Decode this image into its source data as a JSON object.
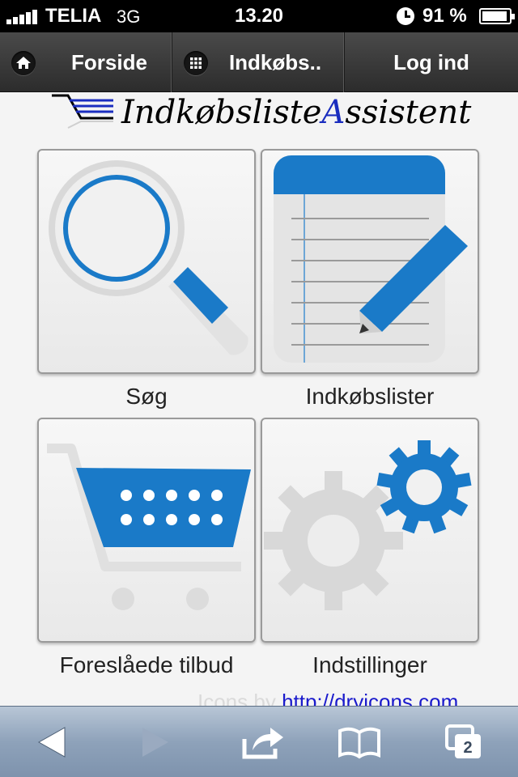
{
  "status_bar": {
    "carrier": "TELIA",
    "network": "3G",
    "time": "13.20",
    "battery_percent": "91 %"
  },
  "nav": {
    "home_label": "Forside",
    "lists_label": "Indkøbs..",
    "login_label": "Log ind"
  },
  "logo": {
    "text_part1": "Indkøbsliste",
    "text_part2": "A",
    "text_part3": "ssistent"
  },
  "tiles": [
    {
      "label": "Søg",
      "icon": "magnifier-icon"
    },
    {
      "label": "Indkøbslister",
      "icon": "notepad-pencil-icon"
    },
    {
      "label": "Foreslåede tilbud",
      "icon": "shopping-cart-icon"
    },
    {
      "label": "Indstillinger",
      "icon": "gears-icon"
    }
  ],
  "credit": {
    "prefix": "Icons by ",
    "link": "http://dryicons.com"
  },
  "toolbar": {
    "tabs_count": "2"
  },
  "colors": {
    "accent_blue": "#1a7ac8",
    "logo_blue": "#1a2dbf",
    "nav_bg": "#3a3a3a"
  }
}
